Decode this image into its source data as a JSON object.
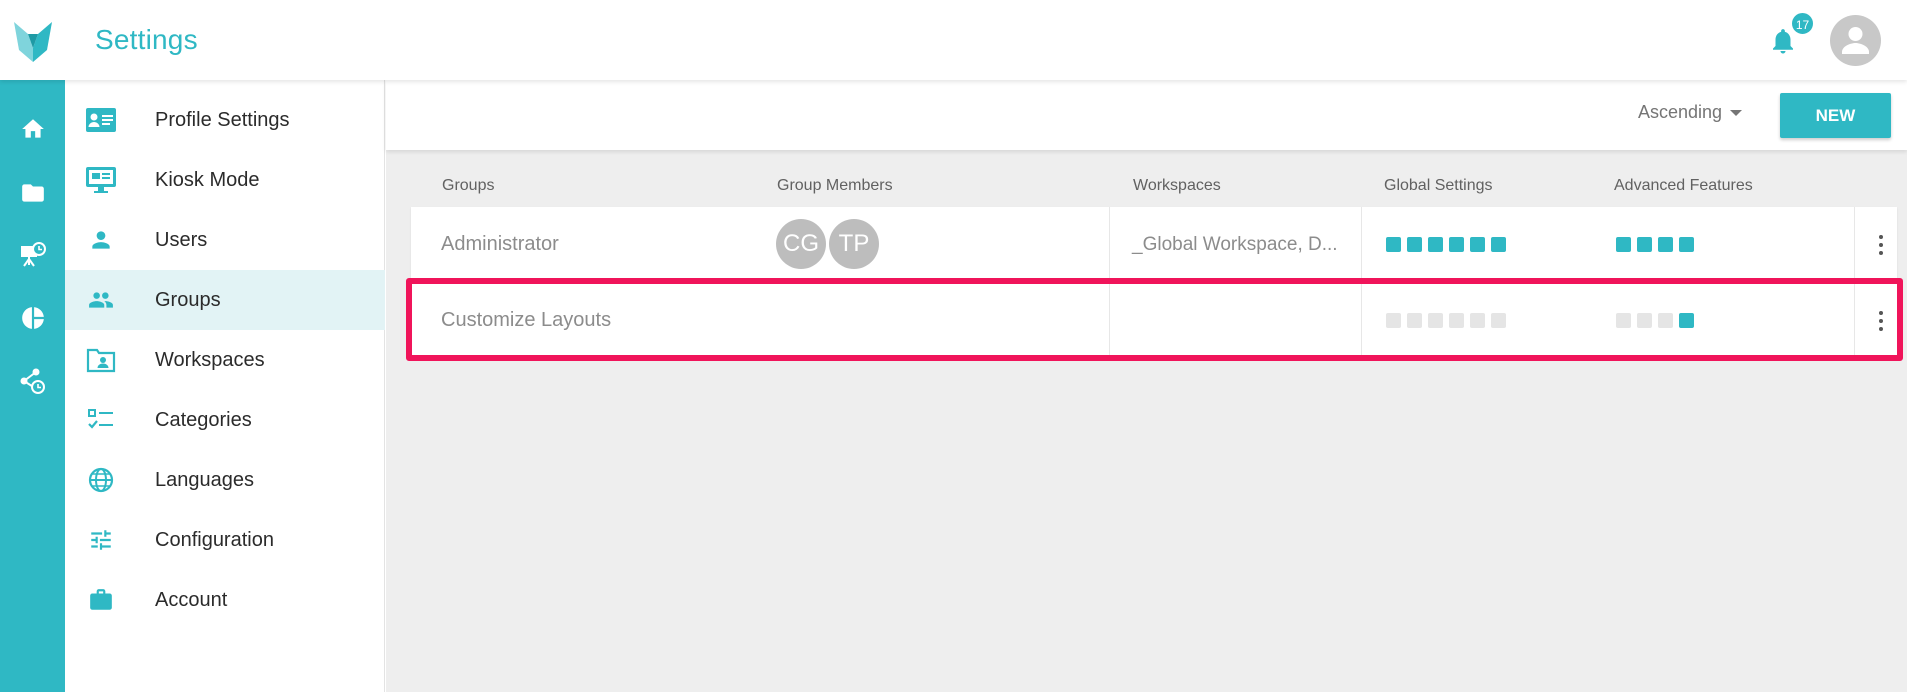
{
  "header": {
    "title": "Settings",
    "notification_count": "17",
    "brand_color": "#2fb8c4"
  },
  "rail": {
    "items": [
      {
        "icon": "home-icon"
      },
      {
        "icon": "folder-icon"
      },
      {
        "icon": "presentation-clock-icon"
      },
      {
        "icon": "pie-chart-icon"
      },
      {
        "icon": "share-clock-icon"
      }
    ]
  },
  "menu": {
    "items": [
      {
        "label": "Profile Settings",
        "icon": "id-card-icon"
      },
      {
        "label": "Kiosk Mode",
        "icon": "monitor-icon"
      },
      {
        "label": "Users",
        "icon": "user-icon"
      },
      {
        "label": "Groups",
        "icon": "group-icon",
        "active": true
      },
      {
        "label": "Workspaces",
        "icon": "folder-user-icon"
      },
      {
        "label": "Categories",
        "icon": "checklist-icon"
      },
      {
        "label": "Languages",
        "icon": "globe-icon"
      },
      {
        "label": "Configuration",
        "icon": "sliders-icon"
      },
      {
        "label": "Account",
        "icon": "briefcase-icon"
      }
    ]
  },
  "toolbar": {
    "sort_label": "Ascending",
    "new_label": "NEW"
  },
  "table": {
    "columns": [
      "Groups",
      "Group Members",
      "Workspaces",
      "Global Settings",
      "Advanced Features"
    ],
    "rows": [
      {
        "group": "Administrator",
        "members": [
          "CG",
          "TP"
        ],
        "workspaces": "_Global Workspace, D...",
        "global_settings": [
          1,
          1,
          1,
          1,
          1,
          1
        ],
        "advanced_features": [
          1,
          1,
          1,
          1
        ]
      },
      {
        "group": "Customize Layouts",
        "members": [],
        "workspaces": "",
        "global_settings": [
          0,
          0,
          0,
          0,
          0,
          0
        ],
        "advanced_features": [
          0,
          0,
          0,
          1
        ],
        "highlighted": true
      }
    ]
  },
  "colors": {
    "accent": "#2fb8c4",
    "highlight": "#f0145a",
    "inactive_square": "#e5e5e5"
  }
}
